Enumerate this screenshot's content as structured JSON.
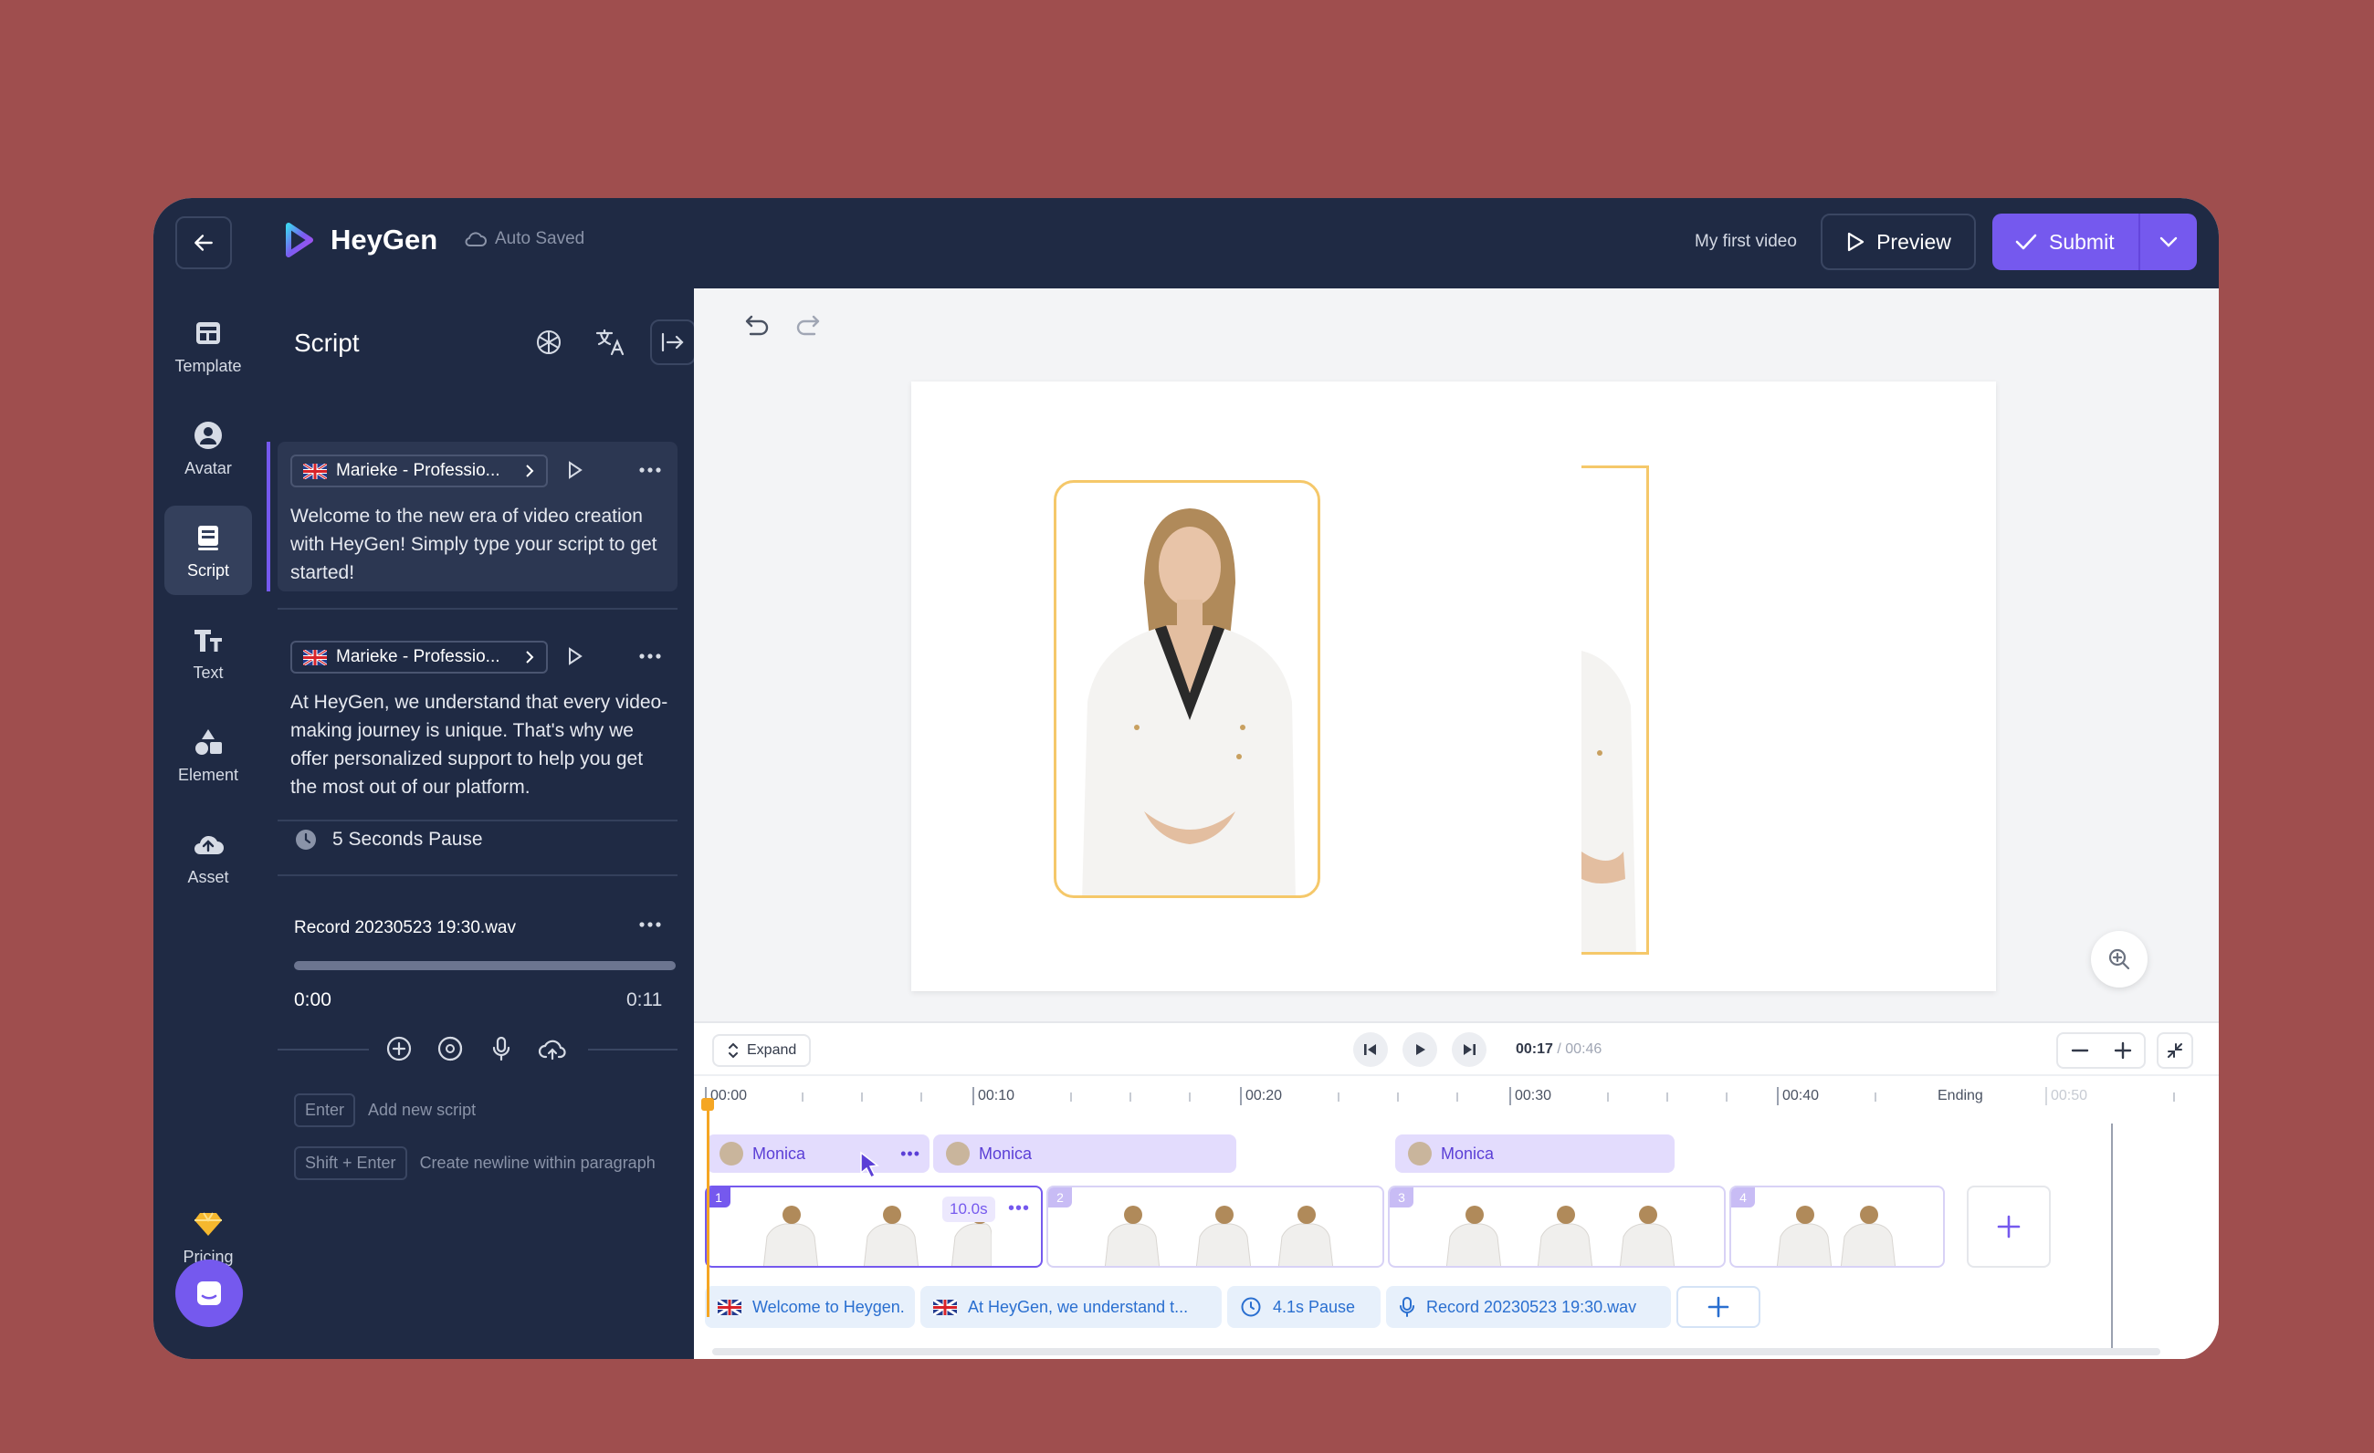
{
  "app": {
    "logo_text": "HeyGen",
    "auto_saved": "Auto Saved",
    "file_name": "My first video",
    "preview_label": "Preview",
    "submit_label": "Submit"
  },
  "nav": {
    "items": [
      {
        "label": "Template",
        "icon": "template-icon"
      },
      {
        "label": "Avatar",
        "icon": "avatar-icon"
      },
      {
        "label": "Script",
        "icon": "script-icon"
      },
      {
        "label": "Text",
        "icon": "text-icon"
      },
      {
        "label": "Element",
        "icon": "element-icon"
      },
      {
        "label": "Asset",
        "icon": "asset-icon"
      }
    ],
    "pricing_label": "Pricing"
  },
  "script_panel": {
    "title": "Script",
    "blocks": [
      {
        "voice": "Marieke - Professio...",
        "text": "Welcome to the new era of video creation with HeyGen! Simply type your script to get started!"
      },
      {
        "voice": "Marieke - Professio...",
        "text": "At HeyGen, we understand that every video-making journey is unique. That's why we offer personalized support to help you get the most out of our platform."
      }
    ],
    "pause_label": "5 Seconds Pause",
    "recording": {
      "name": "Record 20230523 19:30.wav",
      "time_start": "0:00",
      "time_end": "0:11"
    },
    "hints": [
      {
        "key": "Enter",
        "text": "Add new script"
      },
      {
        "key": "Shift + Enter",
        "text": "Create newline within paragraph"
      }
    ]
  },
  "timeline": {
    "expand_label": "Expand",
    "current_time": "00:17",
    "total_time": "/ 00:46",
    "ticks": [
      "00:00",
      "00:10",
      "00:20",
      "00:30",
      "00:40",
      "Ending",
      "00:50"
    ],
    "avatar_chips": [
      "Monica",
      "Monica",
      "Monica"
    ],
    "scenes": [
      {
        "num": "1",
        "duration": "10.0s"
      },
      {
        "num": "2"
      },
      {
        "num": "3"
      },
      {
        "num": "4"
      }
    ],
    "script_chips": [
      "Welcome to Heygen.",
      "At HeyGen, we understand t...",
      "4.1s Pause",
      "Record 20230523 19:30.wav"
    ]
  },
  "colors": {
    "accent": "#7559ee",
    "sidebar_bg": "#1f2a44",
    "highlight": "#f5c86a",
    "background": "#9f4e4e"
  }
}
